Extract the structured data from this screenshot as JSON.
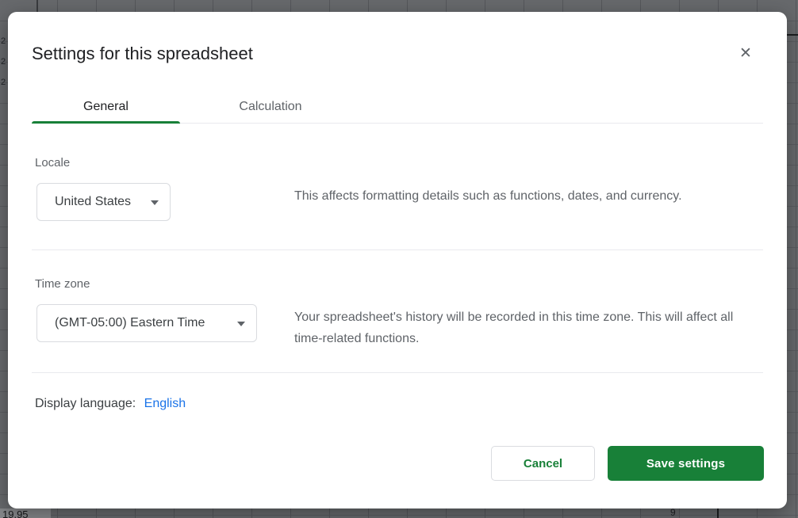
{
  "dialog": {
    "title": "Settings for this spreadsheet",
    "close_icon": "✕",
    "tabs": [
      {
        "label": "General",
        "active": true
      },
      {
        "label": "Calculation",
        "active": false
      }
    ],
    "locale": {
      "label": "Locale",
      "value": "United States",
      "description": "This affects formatting details such as functions, dates, and currency."
    },
    "timezone": {
      "label": "Time zone",
      "value": "(GMT-05:00) Eastern Time",
      "description": "Your spreadsheet's history will be recorded in this time zone. This will affect all time-related functions."
    },
    "display_language": {
      "label": "Display language:",
      "value": "English"
    },
    "footer": {
      "cancel_label": "Cancel",
      "save_label": "Save settings"
    }
  },
  "backdrop": {
    "fragments": {
      "left_rows": [
        "2",
        "2",
        "2"
      ],
      "selected_cell_value": "19.95",
      "bottom_cell_value": "9"
    }
  },
  "colors": {
    "accent_green": "#188038",
    "link_blue": "#1a73e8",
    "scrim_gray": "#67696c",
    "text_primary": "#202124",
    "text_secondary": "#5f6368",
    "border_gray": "#dadce0"
  }
}
